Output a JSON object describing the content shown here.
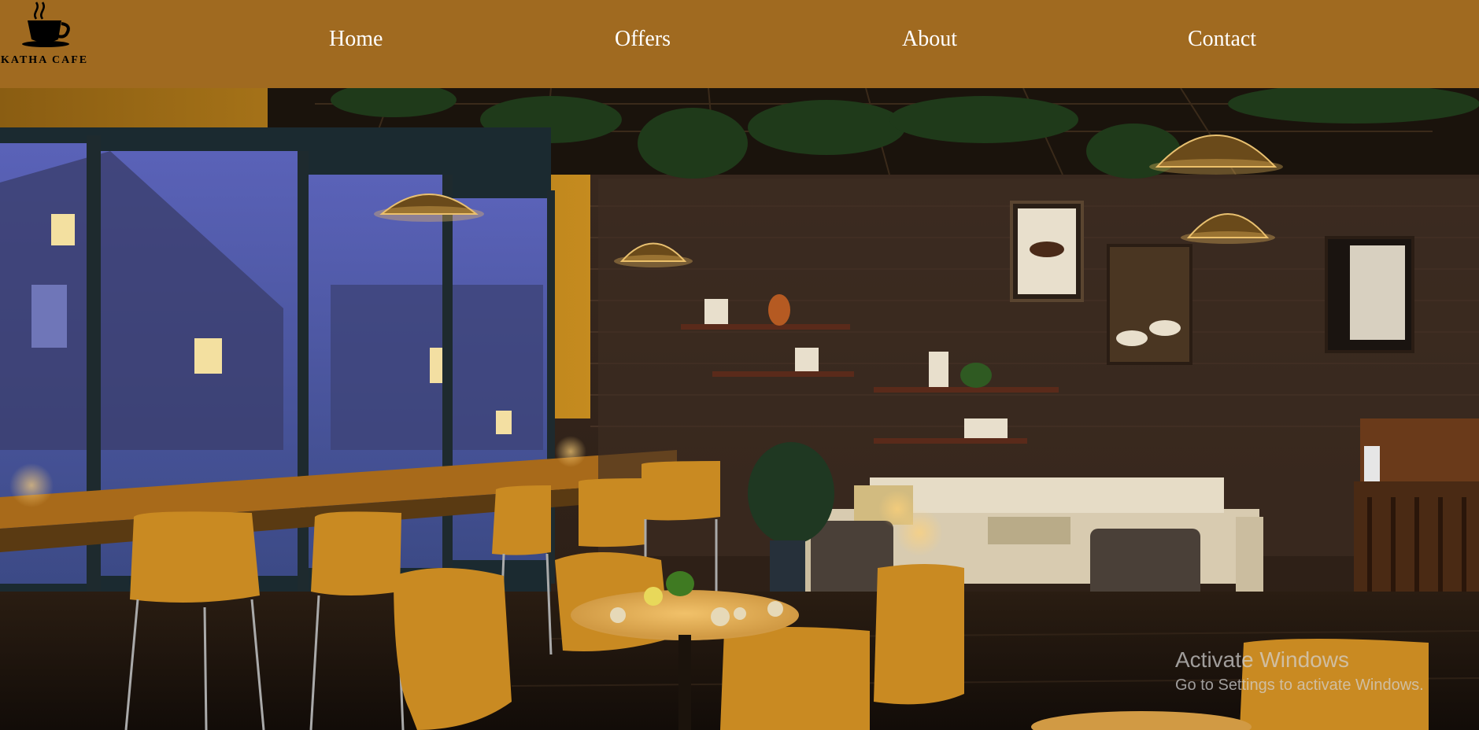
{
  "brand": {
    "name": "KATHA CAFE",
    "logo_icon": "coffee-cup-icon"
  },
  "nav": {
    "items": [
      {
        "label": "Home"
      },
      {
        "label": "Offers"
      },
      {
        "label": "About"
      },
      {
        "label": "Contact"
      }
    ]
  },
  "colors": {
    "navbar": "#a06a20",
    "nav_text": "#ffffff"
  },
  "hero": {
    "image": "cafe-interior-illustration"
  },
  "watermark": {
    "title": "Activate Windows",
    "subtitle": "Go to Settings to activate Windows."
  }
}
